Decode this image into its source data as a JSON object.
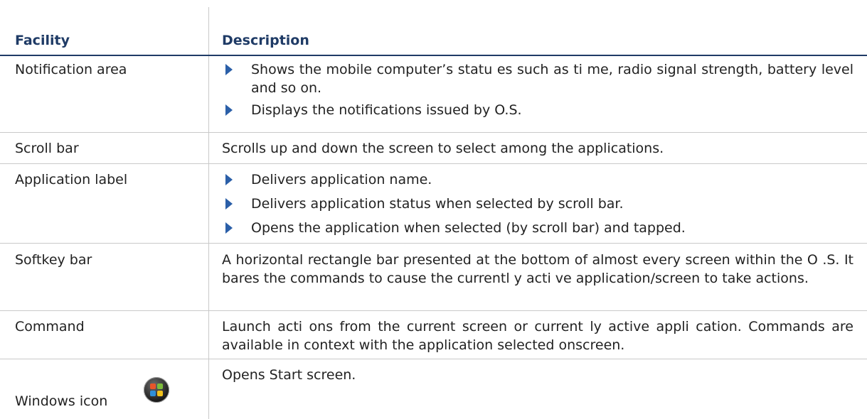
{
  "table": {
    "headers": {
      "facility": "Facility",
      "description": "Description"
    },
    "rows": [
      {
        "facility": "Notification area",
        "bullets": [
          "Shows the mobile computer’s statu es such as ti me, radio signal strength, battery level and so on.",
          "Displays the notifications issued by O.S."
        ]
      },
      {
        "facility": "Scroll bar",
        "description": "Scrolls up and down the screen to select among the applications."
      },
      {
        "facility": "Application label",
        "bullets": [
          "Delivers application name.",
          "Delivers application status when selected by scroll bar.",
          "Opens the application when selected (by scroll bar) and tapped."
        ]
      },
      {
        "facility": "Softkey bar",
        "description": "A horizontal rectangle bar presented at the bottom of almost every screen within the O .S. It bares the commands to cause the currentl y acti ve application/screen to take actions."
      },
      {
        "facility": "Command",
        "description": "Launch acti ons from the current screen or current ly active appli cation. Commands are available in context with the application selected onscreen."
      },
      {
        "facility": "Windows icon",
        "description": "Opens Start screen.",
        "icon": "windows-start-icon"
      }
    ]
  },
  "colors": {
    "header_text": "#1f3b66",
    "bullet": "#2b5fa8",
    "rule": "#c9c9c9"
  }
}
